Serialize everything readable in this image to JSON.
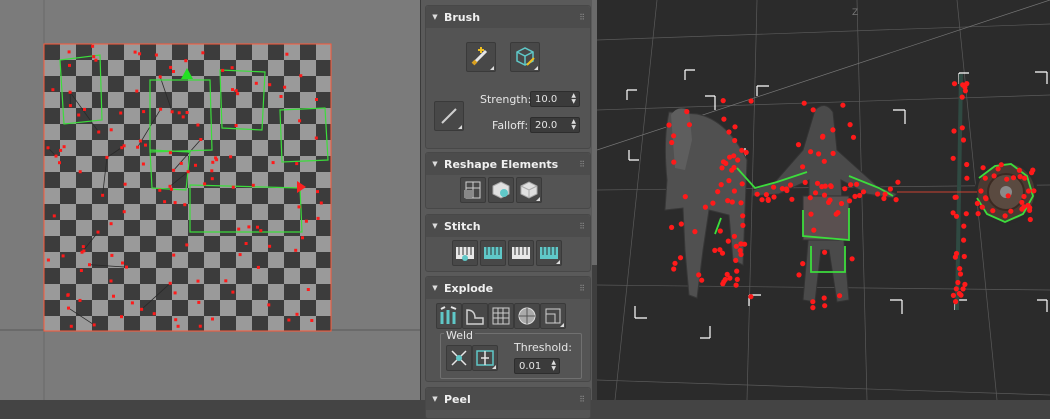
{
  "uv_editor": {
    "name": "UV Editor"
  },
  "panels": {
    "brush": {
      "title": "Brush",
      "strength_label": "Strength:",
      "strength_value": "10.0",
      "falloff_label": "Falloff:",
      "falloff_value": "20.0"
    },
    "reshape": {
      "title": "Reshape Elements"
    },
    "stitch": {
      "title": "Stitch"
    },
    "explode": {
      "title": "Explode",
      "weld_label": "Weld",
      "threshold_label": "Threshold:",
      "threshold_value": "0.01"
    },
    "peel": {
      "title": "Peel"
    }
  },
  "viewport": {
    "name": "Perspective Viewport"
  },
  "colors": {
    "vertex": "#ff1a1a",
    "selection_edge": "#3cdc3c",
    "panel_bg": "#545454",
    "viewport_bg": "#2b2b2b",
    "accent_teal": "#5fc8c8"
  },
  "icons": [
    "paint-brush-icon",
    "relax-cube-icon",
    "brush-stroke-icon",
    "arrange-elements-icon",
    "stitch-icon",
    "explode-icon",
    "weld-icon",
    "peel-icon"
  ]
}
